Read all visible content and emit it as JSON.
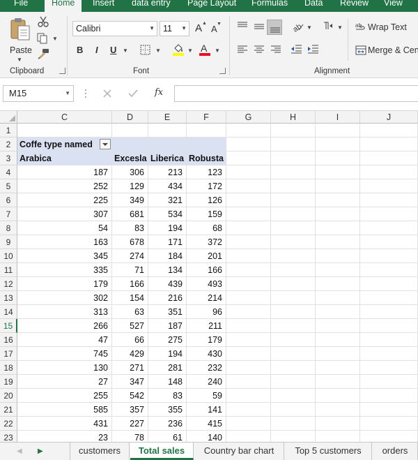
{
  "ribbon": {
    "tabs": [
      "File",
      "Home",
      "Insert",
      "data entry",
      "Page Layout",
      "Formulas",
      "Data",
      "Review",
      "View"
    ],
    "active_tab": "Home",
    "clipboard": {
      "paste_label": "Paste",
      "group_label": "Clipboard"
    },
    "font": {
      "family": "Calibri",
      "size": "11",
      "group_label": "Font",
      "bold": "B",
      "italic": "I",
      "underline": "U",
      "grow": "A",
      "shrink": "A"
    },
    "alignment": {
      "wrap_text": "Wrap Text",
      "merge": "Merge & Center",
      "group_label": "Alignment"
    },
    "colors": {
      "accent": "#217346",
      "highlight": "#ffff00",
      "font_color": "#e81123"
    }
  },
  "formula_bar": {
    "name_box": "M15",
    "fx": "fx",
    "value": ""
  },
  "grid": {
    "columns": [
      "C",
      "D",
      "E",
      "F",
      "G",
      "H",
      "I",
      "J"
    ],
    "rows": [
      "1",
      "2",
      "3",
      "4",
      "5",
      "6",
      "7",
      "8",
      "9",
      "10",
      "11",
      "12",
      "13",
      "14",
      "15",
      "16",
      "17",
      "18",
      "19",
      "20",
      "21",
      "22",
      "23"
    ],
    "selected_row": "15",
    "pivot_title": "Coffe type named",
    "headers": [
      "Arabica",
      "Excesla",
      "Liberica",
      "Robusta"
    ],
    "data": [
      [
        "187",
        "306",
        "213",
        "123"
      ],
      [
        "252",
        "129",
        "434",
        "172"
      ],
      [
        "225",
        "349",
        "321",
        "126"
      ],
      [
        "307",
        "681",
        "534",
        "159"
      ],
      [
        "54",
        "83",
        "194",
        "68"
      ],
      [
        "163",
        "678",
        "171",
        "372"
      ],
      [
        "345",
        "274",
        "184",
        "201"
      ],
      [
        "335",
        "71",
        "134",
        "166"
      ],
      [
        "179",
        "166",
        "439",
        "493"
      ],
      [
        "302",
        "154",
        "216",
        "214"
      ],
      [
        "313",
        "63",
        "351",
        "96"
      ],
      [
        "266",
        "527",
        "187",
        "211"
      ],
      [
        "47",
        "66",
        "275",
        "179"
      ],
      [
        "745",
        "429",
        "194",
        "430"
      ],
      [
        "130",
        "271",
        "281",
        "232"
      ],
      [
        "27",
        "347",
        "148",
        "240"
      ],
      [
        "255",
        "542",
        "83",
        "59"
      ],
      [
        "585",
        "357",
        "355",
        "141"
      ],
      [
        "431",
        "227",
        "236",
        "415"
      ],
      [
        "23",
        "78",
        "61",
        "140"
      ]
    ]
  },
  "sheets": {
    "tabs": [
      "customers",
      "Total sales",
      "Country bar chart",
      "Top 5 customers",
      "orders"
    ],
    "active": "Total sales"
  }
}
